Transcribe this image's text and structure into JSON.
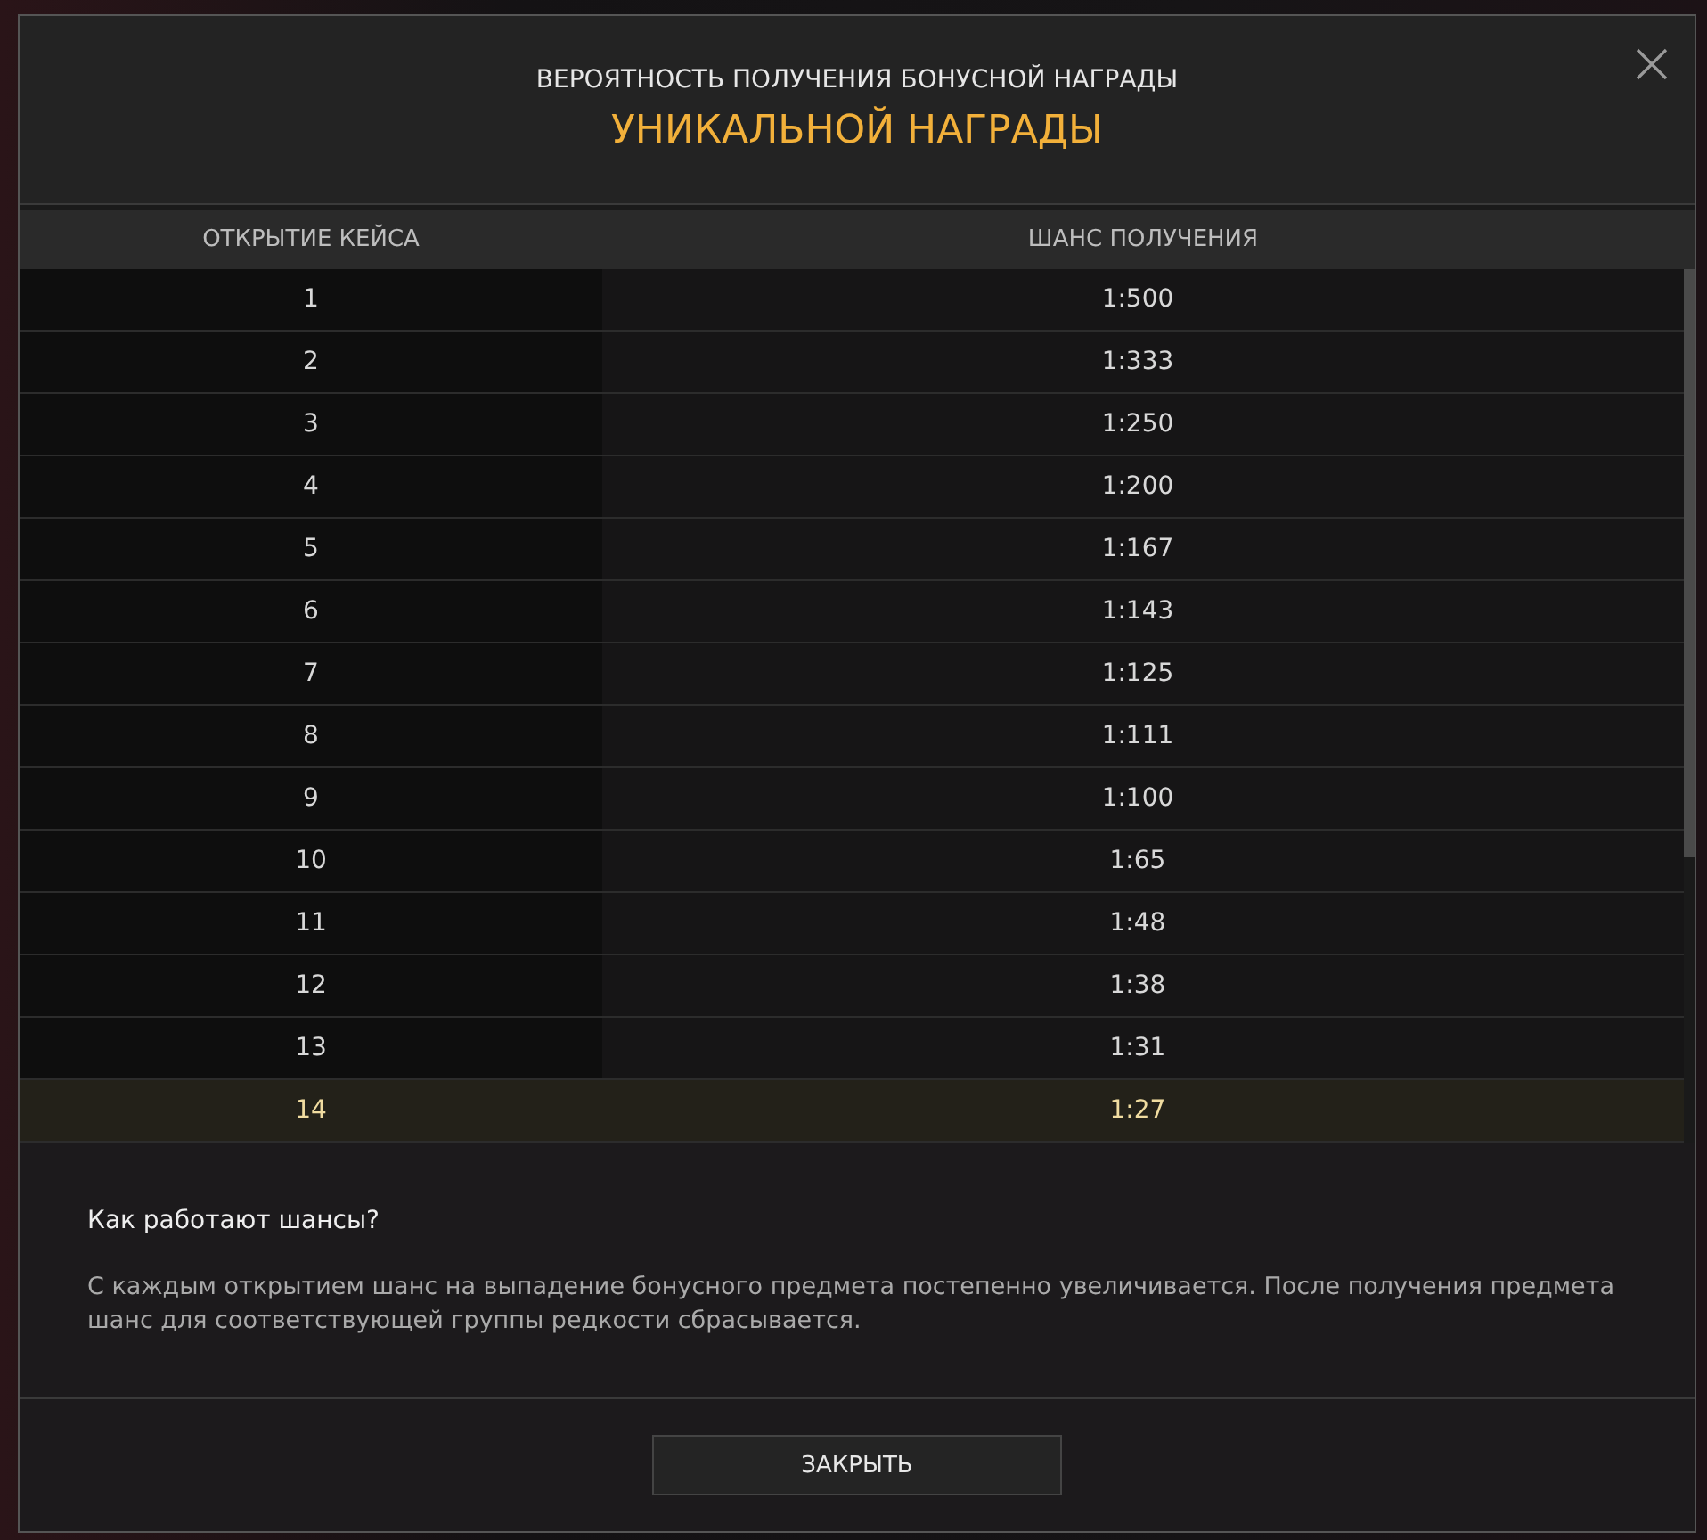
{
  "dialog": {
    "title": "ВЕРОЯТНОСТЬ ПОЛУЧЕНИЯ БОНУСНОЙ НАГРАДЫ",
    "subtitle": "УНИКАЛЬНОЙ НАГРАДЫ"
  },
  "table": {
    "columns": [
      "ОТКРЫТИЕ КЕЙСА",
      "ШАНС ПОЛУЧЕНИЯ"
    ],
    "rows": [
      {
        "opening": "1",
        "chance": "1:500",
        "selected": false
      },
      {
        "opening": "2",
        "chance": "1:333",
        "selected": false
      },
      {
        "opening": "3",
        "chance": "1:250",
        "selected": false
      },
      {
        "opening": "4",
        "chance": "1:200",
        "selected": false
      },
      {
        "opening": "5",
        "chance": "1:167",
        "selected": false
      },
      {
        "opening": "6",
        "chance": "1:143",
        "selected": false
      },
      {
        "opening": "7",
        "chance": "1:125",
        "selected": false
      },
      {
        "opening": "8",
        "chance": "1:111",
        "selected": false
      },
      {
        "opening": "9",
        "chance": "1:100",
        "selected": false
      },
      {
        "opening": "10",
        "chance": "1:65",
        "selected": false
      },
      {
        "opening": "11",
        "chance": "1:48",
        "selected": false
      },
      {
        "opening": "12",
        "chance": "1:38",
        "selected": false
      },
      {
        "opening": "13",
        "chance": "1:31",
        "selected": false
      },
      {
        "opening": "14",
        "chance": "1:27",
        "selected": true
      }
    ]
  },
  "info": {
    "heading": "Как работают шансы?",
    "text": "С каждым открытием шанс на выпадение бонусного предмета постепенно увеличивается. После получения предмета шанс для соответствующей группы редкости сбрасывается."
  },
  "buttons": [
    "ЗАКРЫТЬ"
  ]
}
